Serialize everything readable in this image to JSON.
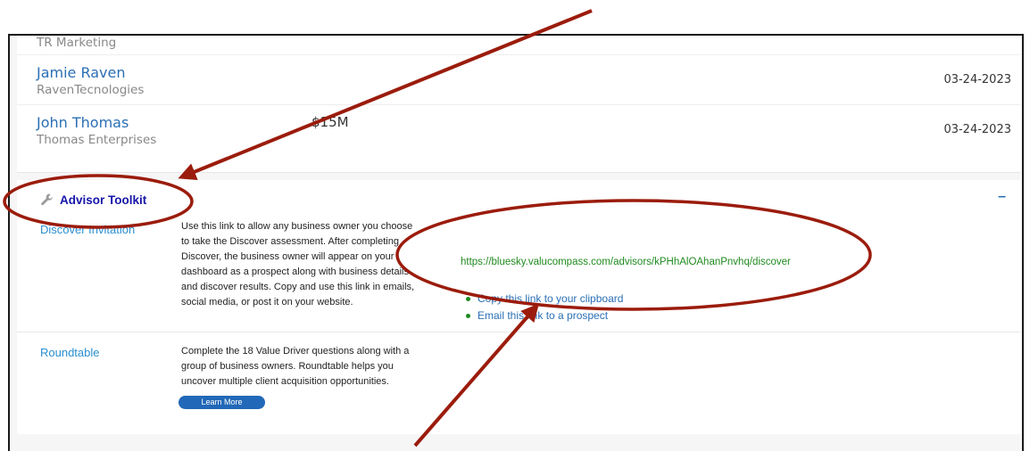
{
  "prospects": [
    {
      "name": "",
      "company": "TR Marketing",
      "amount": "",
      "date": ""
    },
    {
      "name": "Jamie Raven",
      "company": "RavenTecnologies",
      "amount": "",
      "date": "03-24-2023"
    },
    {
      "name": "John Thomas",
      "company": "Thomas Enterprises",
      "amount": "$15M",
      "date": "03-24-2023"
    }
  ],
  "toolkit": {
    "icon": "wrench-icon",
    "title": "Advisor Toolkit",
    "collapse_label": "–",
    "discover": {
      "label": "Discover Invitation",
      "description": "Use this link to allow any business owner you choose to take the Discover assessment. After completing Discover, the business owner will appear on your dashboard as a prospect along with business details and discover results. Copy and use this link in emails, social media, or post it on your website.",
      "url": "https://bluesky.valucompass.com/advisors/kPHhAlOAhanPnvhq/discover",
      "actions": [
        "Copy this link to your clipboard",
        "Email this link to a prospect"
      ]
    },
    "roundtable": {
      "label": "Roundtable",
      "description": "Complete the 18 Value Driver questions along with a group of business owners. Roundtable helps you uncover multiple client acquisition opportunities.",
      "button_label": "Learn More"
    }
  },
  "colors": {
    "annotation": "#9b1c0c",
    "link_blue": "#2a6fb5",
    "url_green": "#1f8a1f",
    "title_navy": "#1515a8",
    "button_blue": "#2168b8"
  }
}
